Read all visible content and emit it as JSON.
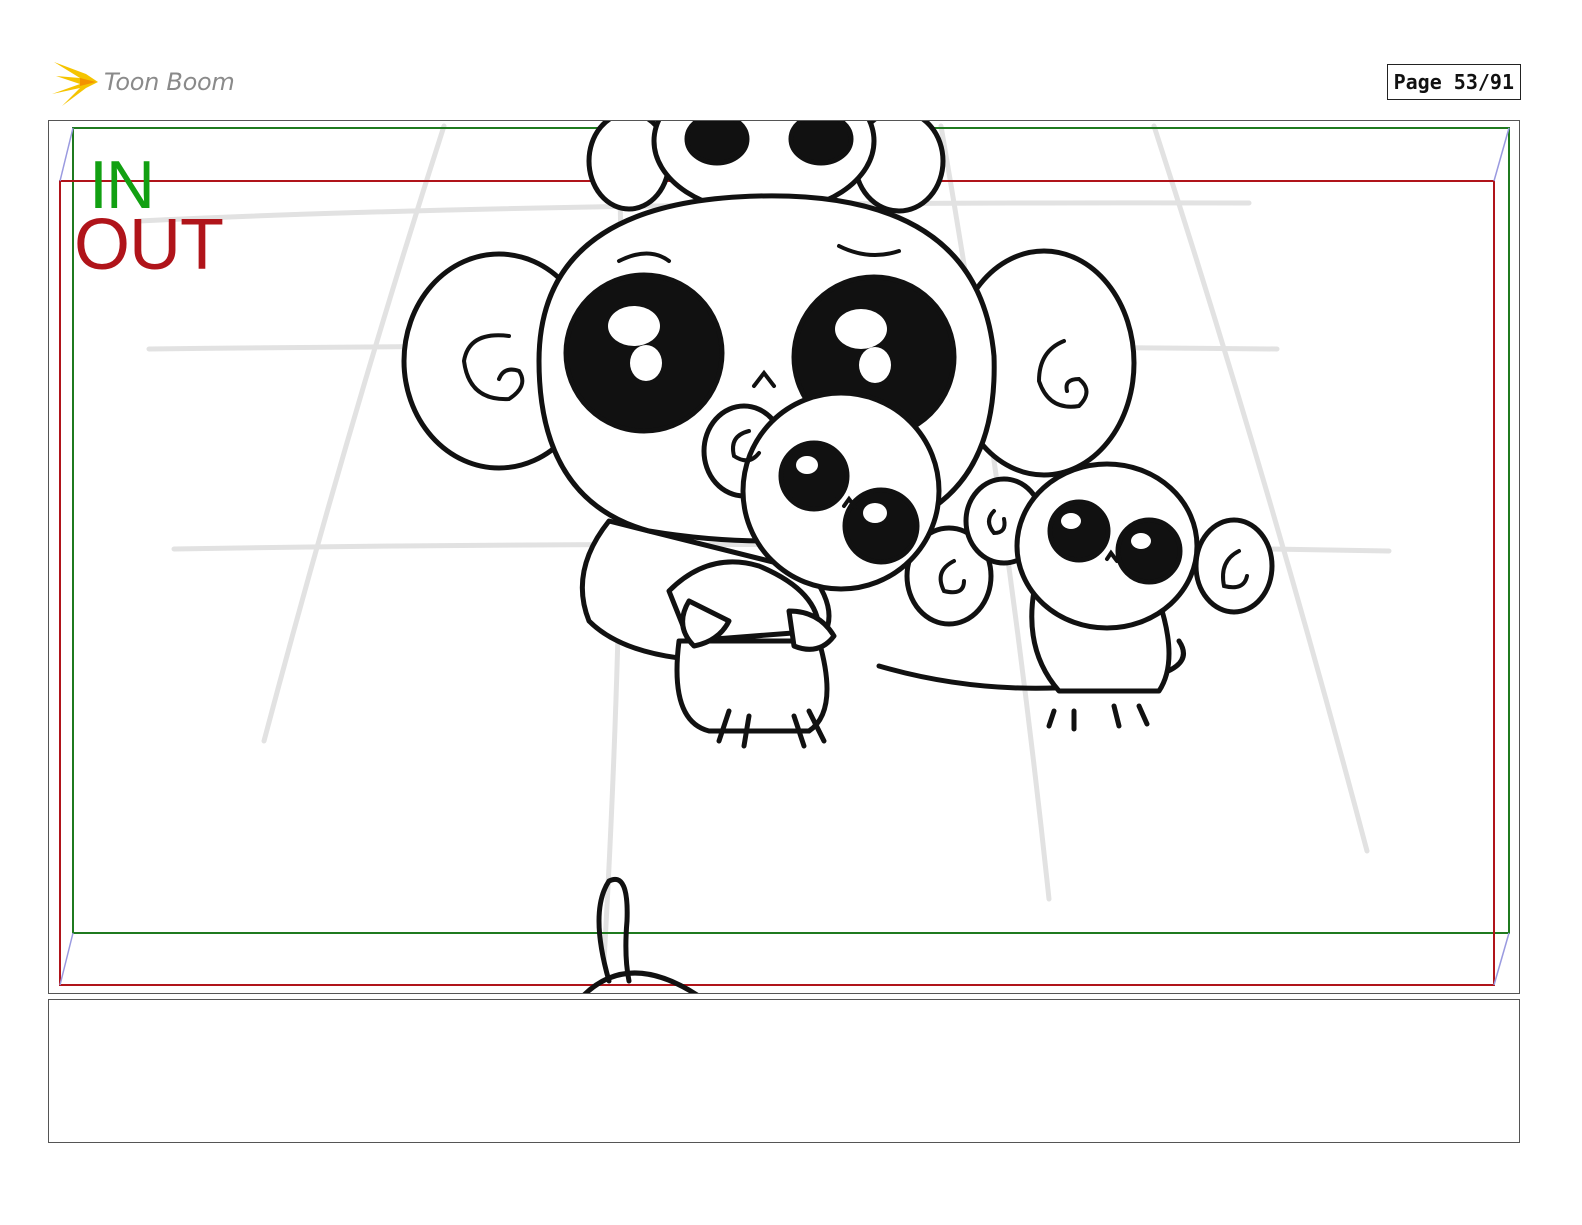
{
  "header": {
    "logo_text": "Toon Boom",
    "page_indicator": "Page 53/91"
  },
  "panel": {
    "in_label": "IN",
    "out_label": "OUT",
    "frame_colors": {
      "in": "#1f7a1f",
      "out": "#b0141a",
      "guide": "#9a9ae0"
    }
  },
  "caption": {
    "text": ""
  }
}
